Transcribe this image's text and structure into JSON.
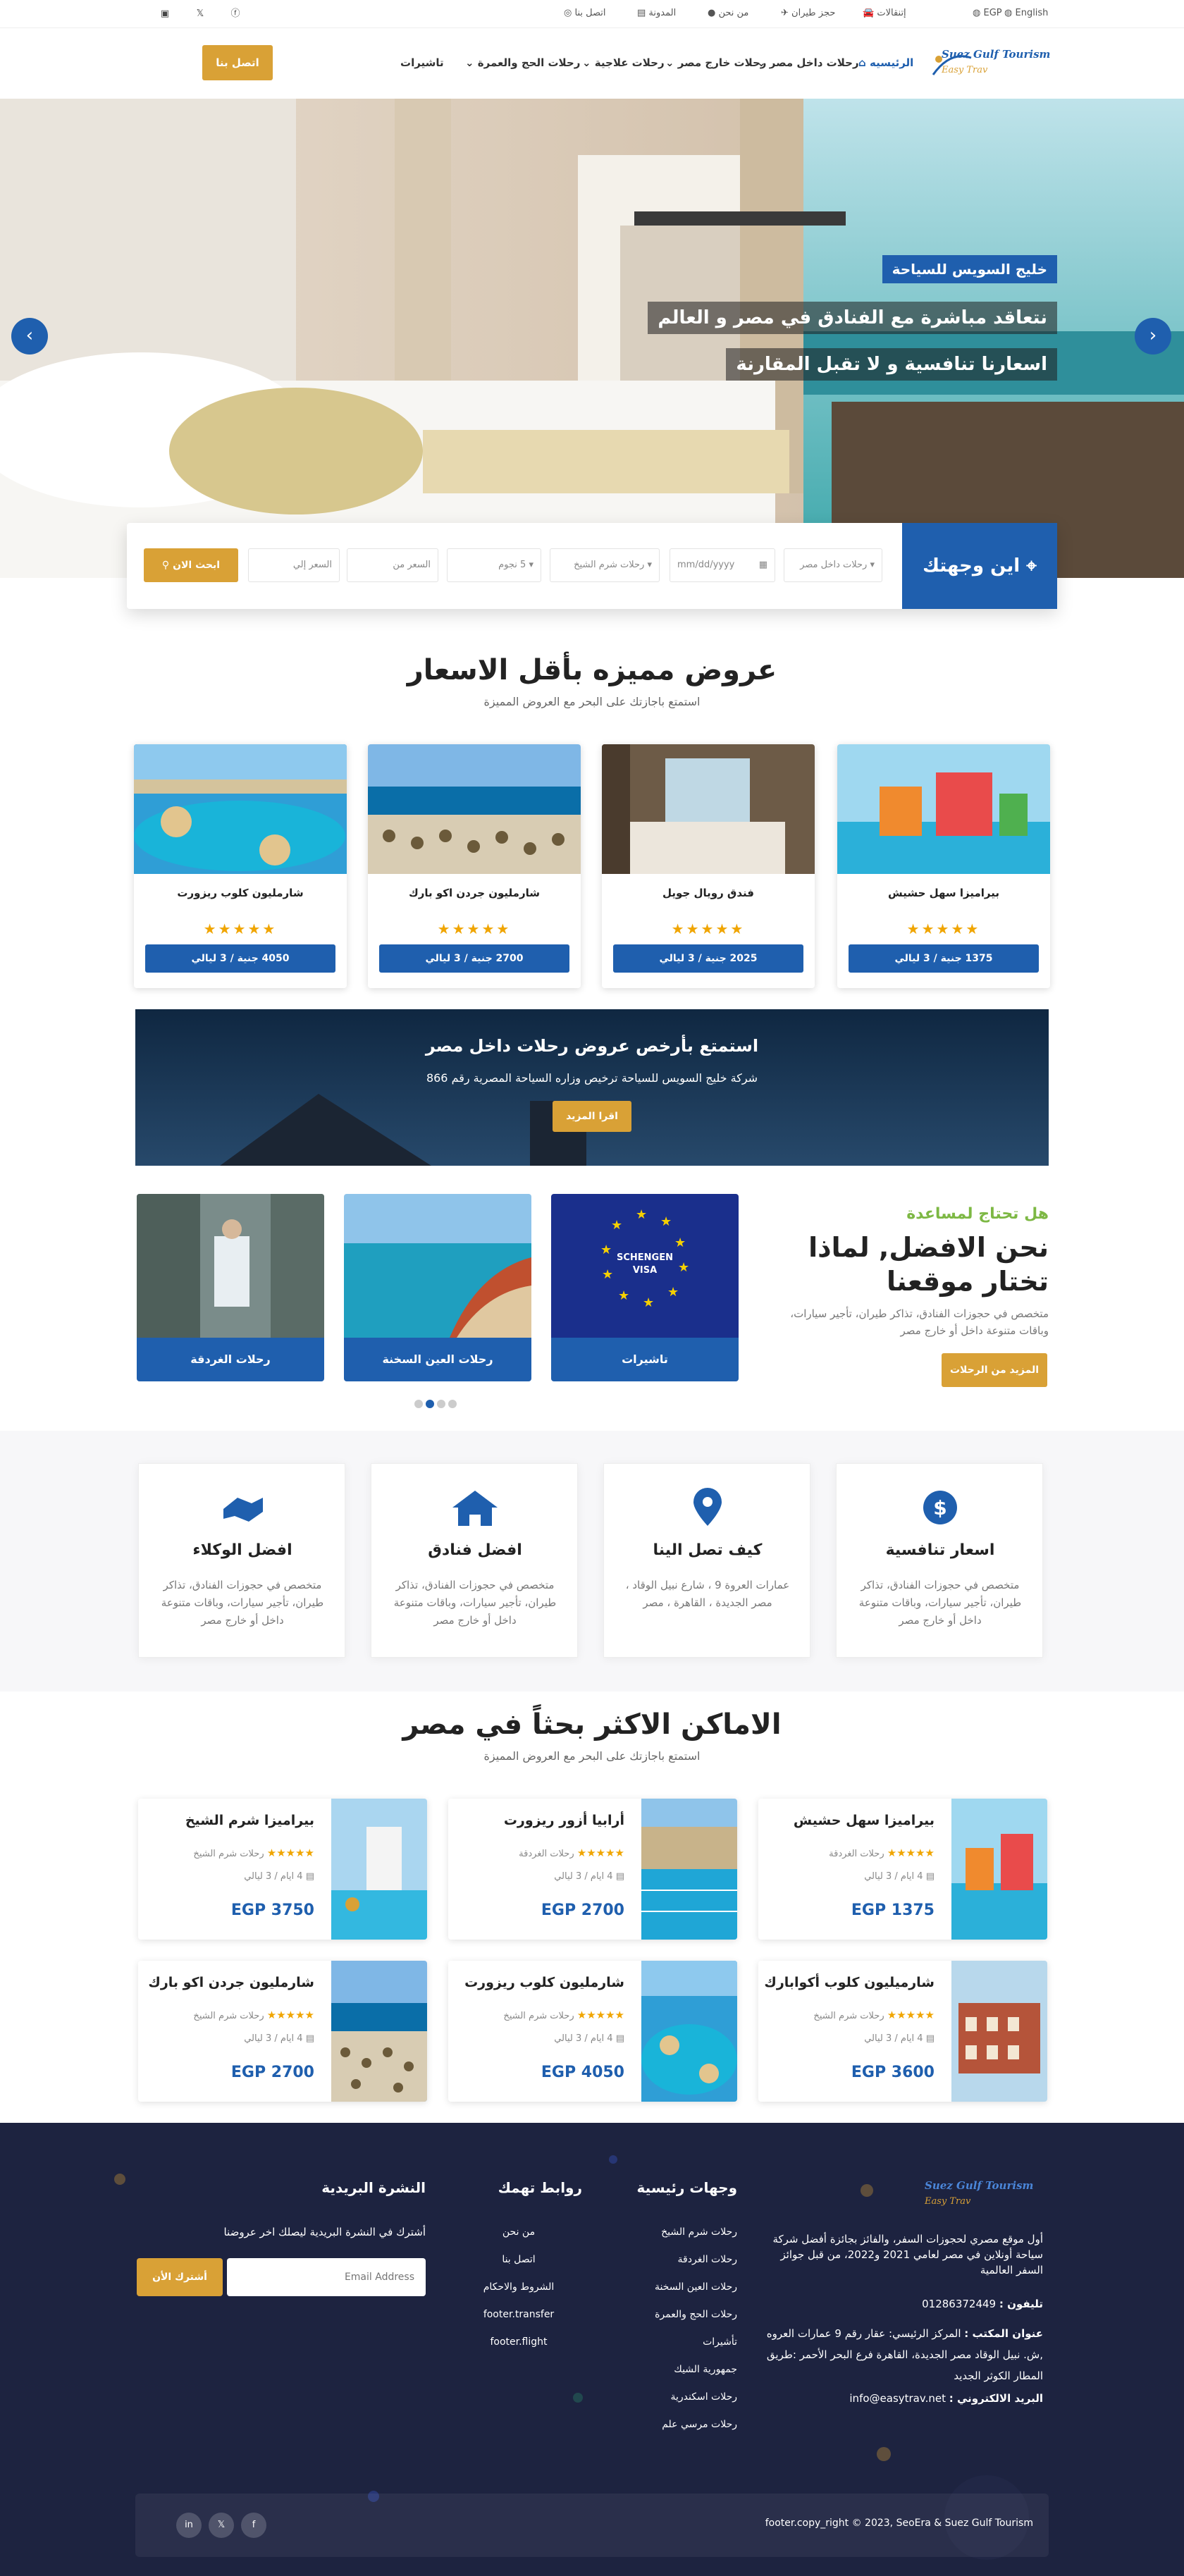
{
  "topbar": {
    "language": "English",
    "currency": "EGP",
    "links": [
      "إتنقالات",
      "حجز طيران",
      "من نحن",
      "المدونة",
      "اتصل بنا"
    ],
    "social": [
      "youtube-icon",
      "twitter-icon",
      "facebook-icon"
    ]
  },
  "brand": {
    "line1": "Suez Gulf Tourism",
    "line2": "Easy Trav"
  },
  "nav": {
    "items": [
      "الرئيسيه",
      "رحلات داخل مصر",
      "رحلات خارج مصر",
      "رحلات علاجية",
      "رحلات الحج والعمرة",
      "تاشيرات"
    ],
    "cta": "اتصل بنا"
  },
  "hero": {
    "badge": "خليج السويس للسياحة",
    "line1": "نتعاقد مباشرة مع الفنادق في مصر و العالم",
    "line2": "اسعارنا تنافسية و لا تقبل المقارنة",
    "prev": "‹",
    "next": "›"
  },
  "search": {
    "title": "اين وجهتك",
    "domestic": "رحلات داخل مصر",
    "date": "mm/dd/yyyy",
    "destination": "رحلات شرم الشيخ",
    "stars": "5 نجوم",
    "price_from": "السعر من",
    "price_to": "السعر إلي",
    "button": "ابحث الان"
  },
  "offers": {
    "title": "عروض مميزه بأقل الاسعار",
    "subtitle": "استمتع باجازتك على البحر مع العروض المميزة",
    "cards": [
      {
        "name": "شارمليون كلوب ريزورت",
        "stars": "★★★★★",
        "price": "4050 جنية / 3 ليالي"
      },
      {
        "name": "شارمليون جردن اكو بارك",
        "stars": "★★★★★",
        "price": "2700 جنية / 3 ليالي"
      },
      {
        "name": "فندق رويال جويل",
        "stars": "★★★★★",
        "price": "2025 جنية / 3 ليالي"
      },
      {
        "name": "بيراميزا سهل حشيش",
        "stars": "★★★★★",
        "price": "1375 جنية / 3 ليالي"
      }
    ]
  },
  "banner": {
    "title": "استمتع بأرخص عروض رحلات داخل مصر",
    "text": "شركة خليج السويس للسياحة ترخيص وزاره السياحة المصرية رقم 866",
    "button": "اقرا المزيد"
  },
  "why": {
    "kicker": "هل تحتاج لمساعدة",
    "title": "نحن الافضل, لماذا تختار موقعنا",
    "text": "متخصص في حجوزات الفنادق، تذاكر طيران، تأجير سيارات، وباقات متنوعة داخل أو خارج مصر",
    "button": "المزيد من الرحلات",
    "destinations": [
      {
        "label": "رحلات الغردقة"
      },
      {
        "label": "رحلات العين السخنة"
      },
      {
        "label": "تاشيرات",
        "visa": "SCHENGEN VISA"
      }
    ]
  },
  "features": [
    {
      "icon": "handshake-icon",
      "title": "افضل الوكلاء",
      "text": "متخصص في حجوزات الفنادق، تذاكر طيران، تأجير سيارات، وباقات متنوعة داخل أو خارج مصر"
    },
    {
      "icon": "home-icon",
      "title": "افضل فنادق",
      "text": "متخصص في حجوزات الفنادق، تذاكر طيران، تأجير سيارات، وباقات متنوعة داخل أو خارج مصر"
    },
    {
      "icon": "map-pin-icon",
      "title": "كيف تصل الينا",
      "text": "عمارات العروة 9 ، شارع نبيل الوقاد ، مصر الجديدة ، القاهرة ، مصر"
    },
    {
      "icon": "dollar-icon",
      "title": "اسعار تنافسية",
      "text": "متخصص في حجوزات الفنادق، تذاكر طيران، تأجير سيارات، وباقات متنوعة داخل أو خارج مصر"
    }
  ],
  "places": {
    "title": "الاماكن الاكثر بحثاً في مصر",
    "subtitle": "استمتع باجازتك على البحر مع العروض المميزة",
    "items": [
      {
        "name": "بيراميزا سهل حشيش",
        "stars": "★★★★★",
        "place": "رحلات الغردقة",
        "duration": "4 ايام / 3 ليالي",
        "price": "EGP 1375"
      },
      {
        "name": "أرابيا أزور ريزورت",
        "stars": "★★★★★",
        "place": "رحلات الغردقة",
        "duration": "4 ايام / 3 ليالي",
        "price": "EGP 2700"
      },
      {
        "name": "بيراميزا شرم الشيخ",
        "stars": "★★★★★",
        "place": "رحلات شرم الشيخ",
        "duration": "4 ايام / 3 ليالي",
        "price": "EGP 3750"
      },
      {
        "name": "شارميليون كلوب أكوابارك",
        "stars": "★★★★★",
        "place": "رحلات شرم الشيخ",
        "duration": "4 ايام / 3 ليالي",
        "price": "EGP 3600"
      },
      {
        "name": "شارمليون كلوب ريزورت",
        "stars": "★★★★★",
        "place": "رحلات شرم الشيخ",
        "duration": "4 ايام / 3 ليالي",
        "price": "EGP 4050"
      },
      {
        "name": "شارمليون جردن اكو بارك",
        "stars": "★★★★★",
        "place": "رحلات شرم الشيخ",
        "duration": "4 ايام / 3 ليالي",
        "price": "EGP 2700"
      }
    ]
  },
  "footer": {
    "about": "أول موقع مصري لحجوزات السفر، والفائز بجائزة أفضل شركة سياحة أونلاين في مصر لعامي 2021 و2022، من قبل جوائز السفر العالمية",
    "phone_label": "تليفون :",
    "phone": "01286372449",
    "office_label": "عنوان المكتب :",
    "office": "المركز الرئيسي: عقار رقم 9 عمارات العروه ,ش. نبيل الوقاد مصر الجديدة، القاهرة فرع البحر الأحمر :طريق المطار الكوثر الجديد",
    "email_label": "البريد الالكتروني :",
    "email": "info@easytrav.net",
    "dest_title": "وجهات رئيسية",
    "dest_links": [
      "رحلات شرم الشيخ",
      "رحلات الغردقة",
      "رحلات العين السخنة",
      "رحلات الحج والعمرة",
      "تأشيرات",
      "جمهورية الشيك",
      "رحلات اسكندرية",
      "رحلات مرسي علم"
    ],
    "quick_title": "روابط تهمك",
    "quick_links": [
      "من نحن",
      "اتصل بنا",
      "الشروط والاحكام",
      "footer.transfer",
      "footer.flight"
    ],
    "news_title": "النشرة البريدية",
    "news_text": "أشترك في النشرة البريدية ليصلك اخر عروضنا",
    "email_placeholder": "Email Address",
    "subscribe": "أشترك الأن",
    "copyright": "footer.copy_right © 2023, SeoEra & Suez Gulf Tourism"
  }
}
